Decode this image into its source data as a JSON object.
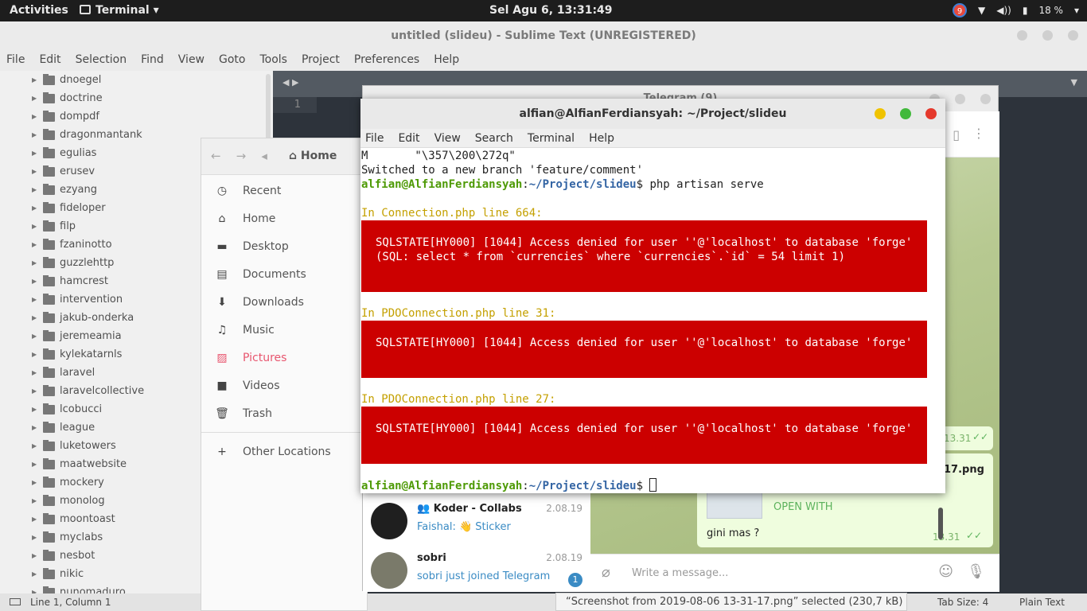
{
  "topbar": {
    "activities": "Activities",
    "app": "Terminal",
    "clock": "Sel Agu  6, 13:31:49",
    "notif_count": "9",
    "battery": "18 %"
  },
  "sublime": {
    "title": "untitled (slideu) - Sublime Text (UNREGISTERED)",
    "menu": [
      "File",
      "Edit",
      "Selection",
      "Find",
      "View",
      "Goto",
      "Tools",
      "Project",
      "Preferences",
      "Help"
    ],
    "folders": [
      "dnoegel",
      "doctrine",
      "dompdf",
      "dragonmantank",
      "egulias",
      "erusev",
      "ezyang",
      "fideloper",
      "filp",
      "fzaninotto",
      "guzzlehttp",
      "hamcrest",
      "intervention",
      "jakub-onderka",
      "jeremeamia",
      "kylekatarnls",
      "laravel",
      "laravelcollective",
      "lcobucci",
      "league",
      "luketowers",
      "maatwebsite",
      "mockery",
      "monolog",
      "moontoast",
      "myclabs",
      "nesbot",
      "nikic",
      "nunomaduro"
    ],
    "line_number": "1",
    "status_left": "Line 1, Column 1",
    "tab_size": "Tab Size: 4",
    "syntax": "Plain Text"
  },
  "files": {
    "location": "Home",
    "places": [
      {
        "icon": "◷",
        "label": "Recent"
      },
      {
        "icon": "⌂",
        "label": "Home"
      },
      {
        "icon": "▬",
        "label": "Desktop"
      },
      {
        "icon": "▤",
        "label": "Documents"
      },
      {
        "icon": "⬇",
        "label": "Downloads"
      },
      {
        "icon": "♫",
        "label": "Music"
      },
      {
        "icon": "▨",
        "label": "Pictures"
      },
      {
        "icon": "■",
        "label": "Videos"
      },
      {
        "icon": "🗑",
        "label": "Trash"
      }
    ],
    "other": "Other Locations",
    "selection": "“Screenshot from 2019-08-06 13-31-17.png” selected  (230,7 kB)"
  },
  "telegram": {
    "title": "Telegram (9)",
    "chats": [
      {
        "name": "Koder - Collabs",
        "date": "2.08.19",
        "sender": "Faishal:",
        "msg": "👋 Sticker"
      },
      {
        "name": "sobri",
        "date": "2.08.19",
        "msg": "sobri just joined Telegram",
        "count": "1"
      }
    ],
    "time1": "13.31",
    "file_name": "17.png",
    "open_with": "OPEN WITH",
    "message": "gini mas ?",
    "time2": "13.31",
    "placeholder": "Write a message..."
  },
  "terminal": {
    "title": "alfian@AlfianFerdiansyah: ~/Project/slideu",
    "menu": [
      "File",
      "Edit",
      "View",
      "Search",
      "Terminal",
      "Help"
    ],
    "line1": "M       \"\\357\\200\\272q\"",
    "line2": "Switched to a new branch 'feature/comment'",
    "prompt_user": "alfian@AlfianFerdiansyah",
    "prompt_path": "~/Project/slideu",
    "command": "$ php artisan serve",
    "err1_loc": "In Connection.php line 664:",
    "err1": "SQLSTATE[HY000] [1044] Access denied for user ''@'localhost' to database 'forge' (SQL: select * from `currencies` where `currencies`.`id` = 54 limit 1)",
    "err2_loc": "In PDOConnection.php line 31:",
    "err2": "SQLSTATE[HY000] [1044] Access denied for user ''@'localhost' to database 'forge'",
    "err3_loc": "In PDOConnection.php line 27:",
    "err3": "SQLSTATE[HY000] [1044] Access denied for user ''@'localhost' to database 'forge'",
    "final_prompt": "$ "
  }
}
